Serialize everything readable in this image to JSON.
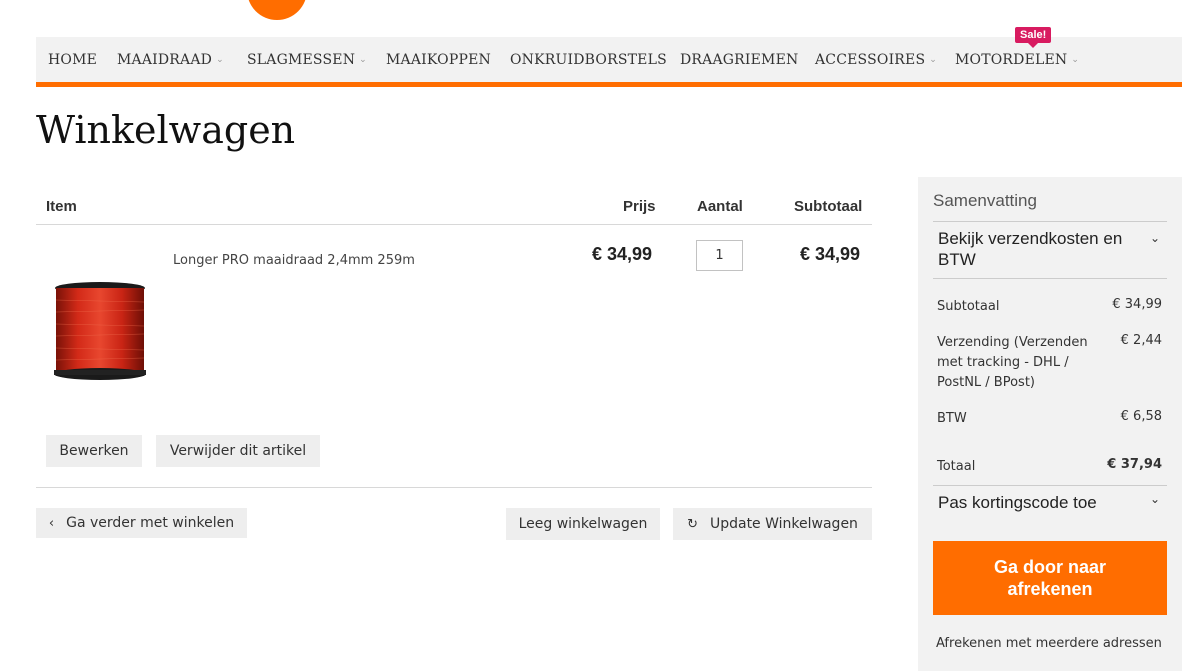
{
  "colors": {
    "accent": "#ff6d00",
    "sale": "#d81b60",
    "panel": "#f2f2f2"
  },
  "nav": {
    "items": [
      {
        "label": "HOME",
        "has_dropdown": false
      },
      {
        "label": "MAAIDRAAD",
        "has_dropdown": true
      },
      {
        "label": "SLAGMESSEN",
        "has_dropdown": true
      },
      {
        "label": "MAAIKOPPEN",
        "has_dropdown": false
      },
      {
        "label": "ONKRUIDBORSTELS",
        "has_dropdown": false
      },
      {
        "label": "DRAAGRIEMEN",
        "has_dropdown": false
      },
      {
        "label": "ACCESSOIRES",
        "has_dropdown": true
      },
      {
        "label": "MOTORDELEN",
        "has_dropdown": true
      }
    ],
    "sale_badge": "Sale!",
    "chevron_icon": "chevron-down-icon"
  },
  "page_title": "Winkelwagen",
  "cart": {
    "headers": {
      "item": "Item",
      "price": "Prijs",
      "qty": "Aantal",
      "subtotal": "Subtotaal"
    },
    "items": [
      {
        "name": "Longer PRO maaidraad 2,4mm 259m",
        "price": "€ 34,99",
        "qty": "1",
        "subtotal": "€ 34,99",
        "edit_label": "Bewerken",
        "remove_label": "Verwijder dit artikel"
      }
    ],
    "continue_label": "Ga verder met winkelen",
    "empty_label": "Leeg winkelwagen",
    "update_label": "Update Winkelwagen"
  },
  "summary": {
    "title": "Samenvatting",
    "shipping_toggle": "Bekijk verzendkosten en BTW",
    "rows": [
      {
        "label": "Subtotaal",
        "value": "€ 34,99"
      },
      {
        "label": "Verzending (Verzenden met tracking - DHL / PostNL / BPost)",
        "value": "€ 2,44"
      },
      {
        "label": "BTW",
        "value": "€ 6,58"
      }
    ],
    "total_label": "Totaal",
    "total_value": "€ 37,94",
    "discount_toggle": "Pas kortingscode toe",
    "checkout_label": "Ga door naar afrekenen",
    "multi_address_label": "Afrekenen met meerdere adressen"
  }
}
